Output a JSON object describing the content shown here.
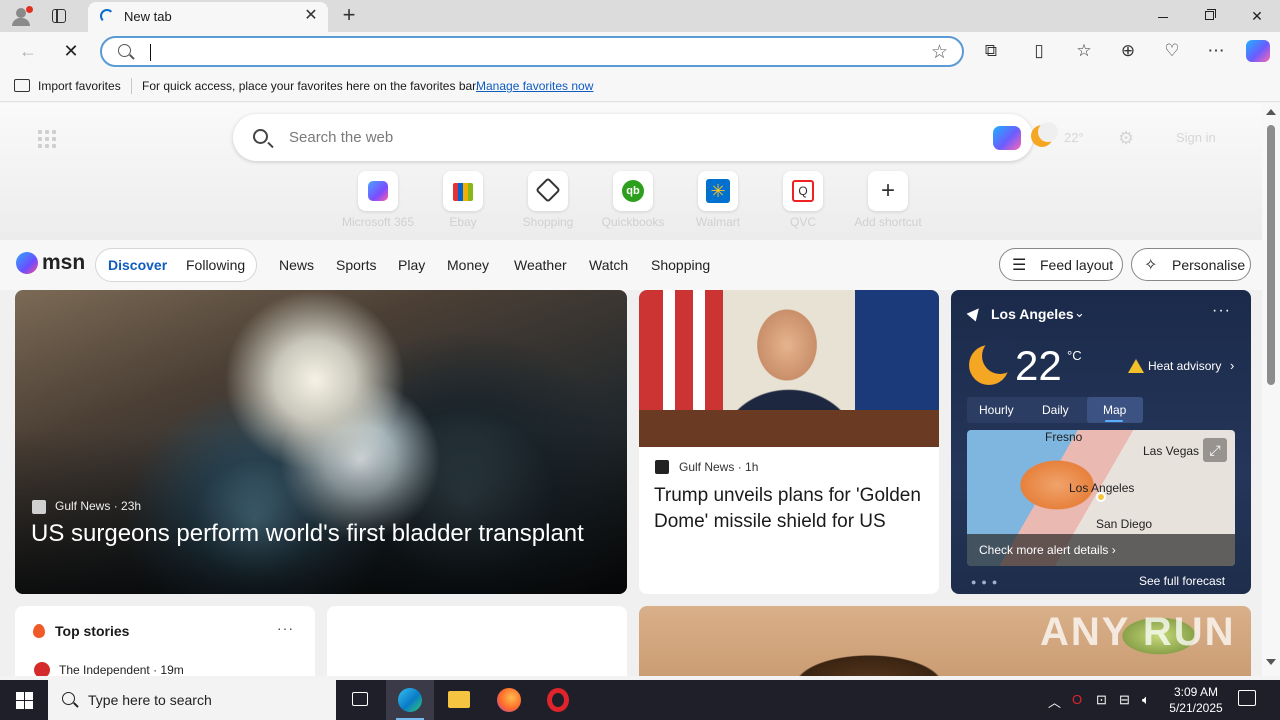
{
  "browser": {
    "tab_title": "New tab",
    "address_value": "",
    "favorites_bar": {
      "import_label": "Import favorites",
      "message": "For quick access, place your favorites here on the favorites bar.",
      "manage_link": "Manage favorites now"
    }
  },
  "newtab": {
    "search_placeholder": "Search the web",
    "weather_temp": "22°",
    "sign_in": "Sign in",
    "shortcuts": [
      {
        "label": "Microsoft 365",
        "icon": "microsoft365-icon"
      },
      {
        "label": "Ebay",
        "icon": "ebay-icon"
      },
      {
        "label": "Shopping",
        "icon": "shopping-tag-icon"
      },
      {
        "label": "Quickbooks",
        "icon": "quickbooks-icon"
      },
      {
        "label": "Walmart",
        "icon": "walmart-icon"
      },
      {
        "label": "QVC",
        "icon": "qvc-icon"
      },
      {
        "label": "Add shortcut",
        "icon": "plus-icon"
      }
    ]
  },
  "feed": {
    "logo": "msn",
    "discover": "Discover",
    "following": "Following",
    "nav": [
      "News",
      "Sports",
      "Play",
      "Money",
      "Weather",
      "Watch",
      "Shopping"
    ],
    "feed_layout": "Feed layout",
    "personalise": "Personalise",
    "hero": {
      "source": "Gulf News",
      "age": "23h",
      "title": "US surgeons perform world's first bladder transplant"
    },
    "card2": {
      "source": "Gulf News",
      "age": "1h",
      "title": "Trump unveils plans for 'Golden Dome' missile shield for US"
    },
    "weather": {
      "location": "Los Angeles",
      "temp": "22",
      "unit": "°C",
      "advisory": "Heat advisory",
      "tabs": [
        "Hourly",
        "Daily",
        "Map"
      ],
      "active_tab": "Map",
      "cities": [
        "Fresno",
        "Las Vegas",
        "Los Angeles",
        "San Diego"
      ],
      "alert_link": "Check more alert details",
      "full_forecast": "See full forecast"
    },
    "top_stories": {
      "heading": "Top stories",
      "source": "The Independent",
      "age": "19m"
    }
  },
  "taskbar": {
    "search_placeholder": "Type here to search",
    "time": "3:09 AM",
    "date": "5/21/2025"
  },
  "watermark": "ANY RUN",
  "colors": {
    "accent": "#0f5cc0",
    "tab_active": "#f7f7f7",
    "taskbar": "#1f1f2a",
    "weather_card": "#1b2a4a"
  }
}
